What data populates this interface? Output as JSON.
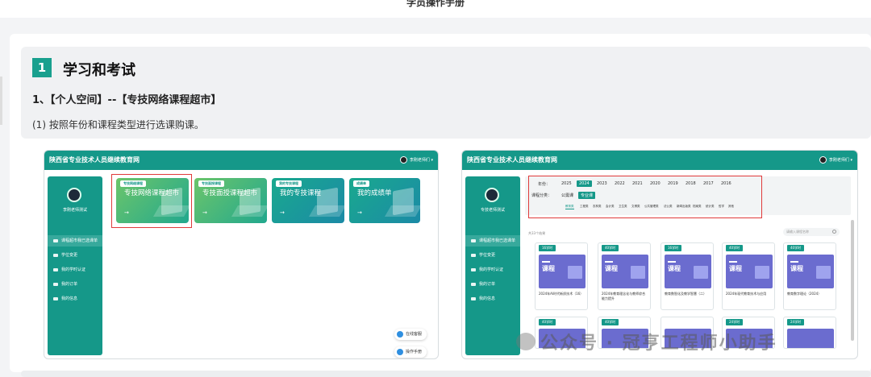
{
  "doc": {
    "title": "学员操作手册"
  },
  "section": {
    "number": "1",
    "title": "学习和考试",
    "subtitle": "1、【个人空间】--【专技网络课程超市】",
    "desc": "(1) 按照年份和课程类型进行选课购课。"
  },
  "shot_left": {
    "site_title": "陕西省专业技术人员继续教育网",
    "user": "李刚老师们 ▾",
    "user_name": "李刚老师测试",
    "menu": [
      "课程超市我已选课单",
      "学位变更",
      "我的学时认证",
      "我的订单",
      "我的信息"
    ],
    "cards": [
      {
        "tag": "专技网络课程",
        "title": "专技网络课程超市"
      },
      {
        "tag": "专技面授课程",
        "title": "专技面授课程超市"
      },
      {
        "tag": "我的专技课程",
        "title": "我的专技课程"
      },
      {
        "tag": "成绩单",
        "title": "我的成绩单"
      }
    ],
    "arrow": "→",
    "float_online": "在线客服",
    "float_manual": "操作手册"
  },
  "shot_right": {
    "site_title": "陕西省专业技术人员继续教育网",
    "user": "李刚老师们 ▾",
    "user_name": "专技老师测试",
    "menu": [
      "课程超市我已选课单",
      "学位变更",
      "我的学时认证",
      "我的订单",
      "我的信息"
    ],
    "year_label": "年份：",
    "years": [
      "2025",
      "2024",
      "2023",
      "2022",
      "2021",
      "2020",
      "2019",
      "2018",
      "2017",
      "2016"
    ],
    "type_label": "课程分类：",
    "types": [
      "公需课",
      "专业课"
    ],
    "categories": [
      "教育类",
      "工程类",
      "农林类",
      "会计类",
      "卫生类",
      "文博类",
      "公共管理类",
      "法公类",
      "新闻出版类",
      "档案类",
      "统计类",
      "哲学",
      "其他"
    ],
    "count": "共33个结果",
    "search_placeholder": "请输入课程名称",
    "courses": [
      {
        "hours": "16学时",
        "thumb": "课程",
        "name": "2024年AI时代新质技术（16）"
      },
      {
        "hours": "40学时",
        "thumb": "课程",
        "name": "2024年教育理念化与教师综合能力提升"
      },
      {
        "hours": "16学时",
        "thumb": "课程",
        "name": "教育数智化及教学智慧（二）"
      },
      {
        "hours": "40学时",
        "thumb": "课程",
        "name": "2024年现代教育技术与应用"
      },
      {
        "hours": "40学时",
        "thumb": "课程",
        "name": "教育数字理论（2024）"
      }
    ],
    "courses_row2": [
      "40学时",
      "40学时",
      "",
      "24学时",
      "24学时"
    ]
  },
  "watermark": "公众号 · 冠亨工程师小助手",
  "colors": {
    "teal": "#159889",
    "red": "#e03a3a",
    "purple": "#6b6ccf"
  }
}
